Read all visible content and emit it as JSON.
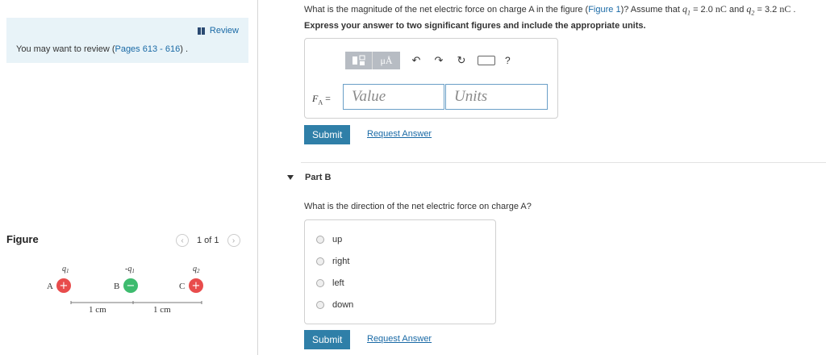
{
  "left": {
    "review_label": "Review",
    "review_text_prefix": "You may want to review (",
    "review_pages_link": "Pages 613 - 616",
    "review_text_suffix": ") .",
    "figure_title": "Figure",
    "pager_text": "1 of 1",
    "figure": {
      "charges": [
        {
          "point": "A",
          "label": "q",
          "sub": "1",
          "sign": "+",
          "neg": false
        },
        {
          "point": "B",
          "label": "-q",
          "sub": "1",
          "sign": "−",
          "neg": false
        },
        {
          "point": "C",
          "label": "q",
          "sub": "2",
          "sign": "+",
          "neg": false
        }
      ],
      "distance_1": "1 cm",
      "distance_2": "1 cm",
      "colors": {
        "positive": "#e84c4c",
        "negative": "#3dbb6e"
      }
    }
  },
  "partA": {
    "question_prefix": "What is the magnitude of the net electric force on charge A in the figure (",
    "figure_link": "Figure 1",
    "question_mid": ")? Assume that ",
    "q1_value": "= 2.0",
    "q1_unit": "nC",
    "and_text": "and",
    "q2_value": "= 3.2",
    "q2_unit": "nC",
    "instructions": "Express your answer to two significant figures and include the appropriate units.",
    "input_label_var": "F",
    "input_label_sub": "A",
    "input_label_eq": " =",
    "value_placeholder": "Value",
    "units_placeholder": "Units",
    "unit_button": "μÅ",
    "help": "?",
    "submit_label": "Submit",
    "request_answer_label": "Request Answer"
  },
  "partB": {
    "title": "Part B",
    "question": "What is the direction of the net electric force on charge A?",
    "options": [
      "up",
      "right",
      "left",
      "down"
    ],
    "submit_label": "Submit",
    "request_answer_label": "Request Answer"
  }
}
